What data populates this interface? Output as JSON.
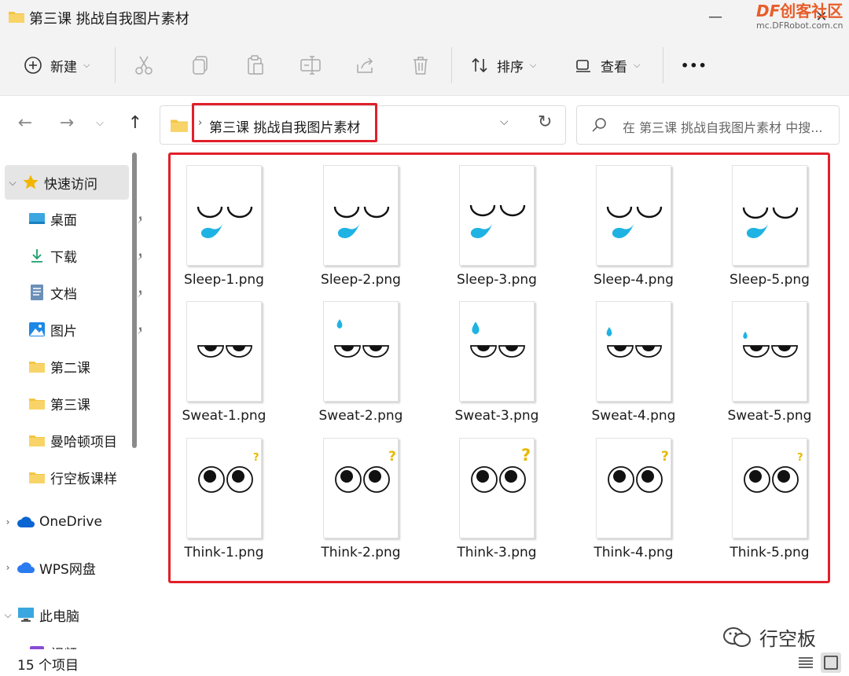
{
  "window": {
    "title": "第三课 挑战自我图片素材"
  },
  "watermark": {
    "logo_df": "DF",
    "logo_cn": "创客社区",
    "url": "mc.DFRobot.com.cn",
    "corner": "行空板"
  },
  "toolbar": {
    "new_label": "新建",
    "sort_label": "排序",
    "view_label": "查看",
    "more_label": "•••"
  },
  "address": {
    "path": "第三课 挑战自我图片素材"
  },
  "search": {
    "placeholder": "在 第三课 挑战自我图片素材 中搜..."
  },
  "sidebar": {
    "quick_access": "快速访问",
    "items": [
      {
        "label": "桌面",
        "icon": "desktop-icon",
        "pinned": true
      },
      {
        "label": "下载",
        "icon": "download-icon",
        "pinned": true
      },
      {
        "label": "文档",
        "icon": "document-icon",
        "pinned": true
      },
      {
        "label": "图片",
        "icon": "pictures-icon",
        "pinned": true
      },
      {
        "label": "第二课",
        "icon": "folder-icon",
        "pinned": false
      },
      {
        "label": "第三课",
        "icon": "folder-icon",
        "pinned": false
      },
      {
        "label": "曼哈顿项目",
        "icon": "folder-icon",
        "pinned": false
      },
      {
        "label": "行空板课样",
        "icon": "folder-icon",
        "pinned": false
      }
    ],
    "onedrive": "OneDrive",
    "wps": "WPS网盘",
    "this_pc": "此电脑",
    "videos": "视频"
  },
  "files": [
    {
      "name": "Sleep-1.png",
      "kind": "sleep",
      "variant": 1
    },
    {
      "name": "Sleep-2.png",
      "kind": "sleep",
      "variant": 2
    },
    {
      "name": "Sleep-3.png",
      "kind": "sleep",
      "variant": 3
    },
    {
      "name": "Sleep-4.png",
      "kind": "sleep",
      "variant": 4
    },
    {
      "name": "Sleep-5.png",
      "kind": "sleep",
      "variant": 5
    },
    {
      "name": "Sweat-1.png",
      "kind": "sweat",
      "variant": 1
    },
    {
      "name": "Sweat-2.png",
      "kind": "sweat",
      "variant": 2
    },
    {
      "name": "Sweat-3.png",
      "kind": "sweat",
      "variant": 3
    },
    {
      "name": "Sweat-4.png",
      "kind": "sweat",
      "variant": 4
    },
    {
      "name": "Sweat-5.png",
      "kind": "sweat",
      "variant": 5
    },
    {
      "name": "Think-1.png",
      "kind": "think",
      "variant": 1
    },
    {
      "name": "Think-2.png",
      "kind": "think",
      "variant": 2
    },
    {
      "name": "Think-3.png",
      "kind": "think",
      "variant": 3
    },
    {
      "name": "Think-4.png",
      "kind": "think",
      "variant": 4
    },
    {
      "name": "Think-5.png",
      "kind": "think",
      "variant": 5
    }
  ],
  "status": {
    "item_count": "15 个项目"
  },
  "colors": {
    "highlight": "#e0202a",
    "drop": "#1fb3e3",
    "question": "#e8b800",
    "folder": "#f4c542",
    "accent": "#0067c0"
  }
}
